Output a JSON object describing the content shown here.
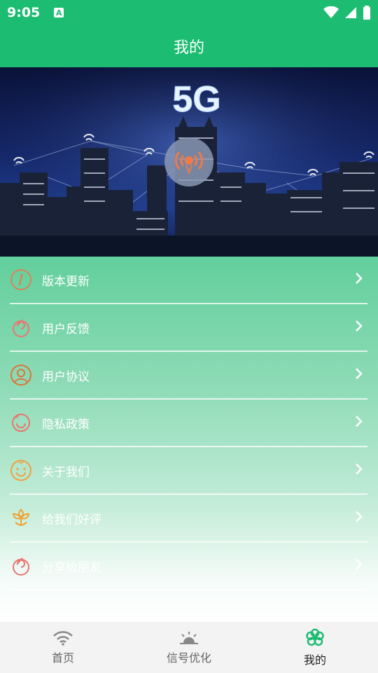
{
  "status_bar": {
    "time": "9:05",
    "notification_glyph": "A"
  },
  "title": "我的",
  "banner": {
    "text": "5G"
  },
  "menu": [
    {
      "label": "版本更新",
      "icon": "info-icon",
      "color": "#e87b4f"
    },
    {
      "label": "用户反馈",
      "icon": "swirl-icon",
      "color": "#e8776f"
    },
    {
      "label": "用户协议",
      "icon": "user-icon",
      "color": "#e0733a"
    },
    {
      "label": "隐私政策",
      "icon": "smile-icon",
      "color": "#e8776f"
    },
    {
      "label": "关于我们",
      "icon": "baby-face-icon",
      "color": "#f0a040"
    },
    {
      "label": "给我们好评",
      "icon": "flower-icon",
      "color": "#f0a030"
    },
    {
      "label": "分享给朋友",
      "icon": "swirl-icon",
      "color": "#e8776f"
    }
  ],
  "bottom_nav": {
    "tabs": [
      {
        "label": "首页",
        "icon": "wifi-icon"
      },
      {
        "label": "信号优化",
        "icon": "sunrise-icon"
      },
      {
        "label": "我的",
        "icon": "flower-active-icon",
        "active": true
      }
    ],
    "active_color": "#1cbc72"
  },
  "colors": {
    "brand_green": "#1cbc72"
  }
}
